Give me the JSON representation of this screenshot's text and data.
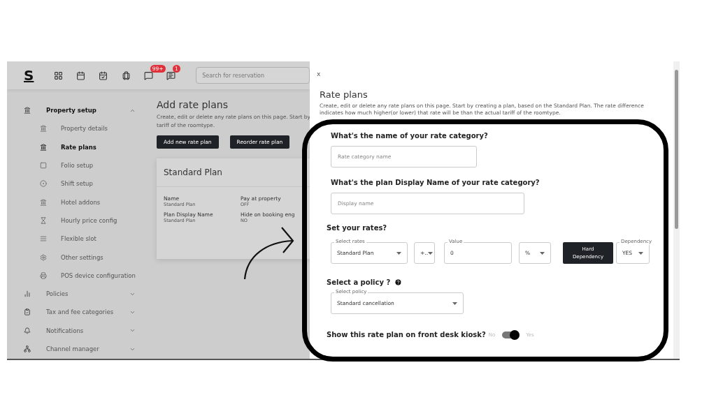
{
  "topbar": {
    "logo": "S",
    "badges": [
      {
        "count": "99+"
      },
      {
        "count": "1"
      }
    ],
    "search": {
      "placeholder": "Search for reservation"
    }
  },
  "sidebar": {
    "items": [
      {
        "label": "Property setup",
        "expanded": true,
        "children": [
          {
            "label": "Property details",
            "selected": false
          },
          {
            "label": "Rate plans",
            "selected": true
          },
          {
            "label": "Folio setup",
            "selected": false
          },
          {
            "label": "Shift setup",
            "selected": false
          },
          {
            "label": "Hotel addons",
            "selected": false
          },
          {
            "label": "Hourly price config",
            "selected": false
          },
          {
            "label": "Flexible slot",
            "selected": false
          },
          {
            "label": "Other settings",
            "selected": false
          },
          {
            "label": "POS device configuration",
            "selected": false
          }
        ]
      },
      {
        "label": "Policies",
        "expanded": false
      },
      {
        "label": "Tax and fee categories",
        "expanded": false
      },
      {
        "label": "Notifications",
        "expanded": false
      },
      {
        "label": "Channel manager",
        "expanded": false
      }
    ]
  },
  "page": {
    "title": "Add rate plans",
    "description_lines": [
      "Create, edit or delete any rate plans on this page. Start by",
      "tariff of the roomtype."
    ],
    "buttons": [
      "Add new rate plan",
      "Reorder rate plan"
    ],
    "plan_card": {
      "title": "Standard Plan",
      "fields": [
        {
          "label": "Name",
          "value": "Standard Plan"
        },
        {
          "label": "Pay at property",
          "value": "OFF"
        },
        {
          "label": "Plan Display Name",
          "value": "Standard Plan"
        },
        {
          "label": "Hide on booking eng",
          "value": "NO"
        }
      ]
    }
  },
  "drawer": {
    "close": "x",
    "title": "Rate plans",
    "description": "Create, edit or delete any rate plans on this page. Start by creating a plan, based on the Standard Plan. The rate difference indicates how much higher(or lower) that rate will be than the actual tariff of the roomtype.",
    "name_question": "What's the name of your rate category?",
    "name_placeholder": "Rate category name",
    "display_question": "What's the plan **Display Name** of your rate category?",
    "display_placeholder": "Display name",
    "rates_question": "Set your rates?",
    "rate_controls": [
      {
        "kind": "select",
        "label": "Select rates",
        "value": "Standard Plan"
      },
      {
        "kind": "select",
        "value": "+.."
      },
      {
        "kind": "input",
        "label": "Value",
        "value": "0"
      },
      {
        "kind": "select",
        "value": "%"
      },
      {
        "kind": "button",
        "value": "Hard Dependency"
      },
      {
        "kind": "select",
        "label": "Dependency",
        "value": "YES"
      }
    ],
    "policy_question": "Select a policy ?",
    "policy_select": {
      "label": "Select policy",
      "value": "Standard cancellation"
    },
    "kiosk": {
      "question": "Show this rate plan on front desk kiosk?",
      "off_label": "No",
      "on_label": "Yes",
      "on": true
    }
  }
}
